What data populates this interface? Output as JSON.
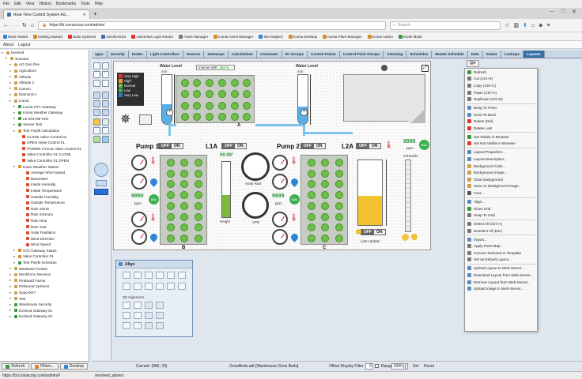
{
  "browser": {
    "menu": [
      "File",
      "Edit",
      "View",
      "History",
      "Bookmarks",
      "Tools",
      "Help"
    ],
    "tab_title": "Real-Time Control System Ad...",
    "url": "https://bi.iconiacorp.com/admin/",
    "search_placeholder": "Search",
    "bookmarks": [
      "Most Visited",
      "Getting Started",
      "Dalio Systems",
      "ADURASSS",
      "Universal Login Router",
      "Asset Manager",
      "Iconia Asset Manager",
      "SEAnalytics",
      "Iconia Desktop",
      "Iconia Plant Manager",
      "Iconia Admin",
      "Kiosk Mode"
    ],
    "status_url": "https://bi.iconiacorp.com/admin/#"
  },
  "app": {
    "menu": [
      "About",
      "Logout"
    ],
    "tabs": [
      "apps",
      "Security",
      "Nodes",
      "Light Controllers",
      "Devices",
      "Gateways",
      "Calculations",
      "Constants",
      "I/C Groups",
      "Control Points",
      "Control Point Groups",
      "Alarming",
      "Schedules",
      "Master Schedule",
      "Data",
      "Status",
      "Lookups",
      "Layouts"
    ],
    "active_tab": "Layouts",
    "bottom_buttons": [
      "Refresh",
      "Filters...",
      "Desktop"
    ],
    "footer_path": "/evolved_admin/"
  },
  "tree": [
    {
      "label": "Evolved",
      "indent": 0,
      "color": "#c9a14a"
    },
    {
      "label": "Sonoma",
      "indent": 1,
      "color": "#c9a14a"
    },
    {
      "label": "AG Geo Dev",
      "indent": 2,
      "color": "#c9a14a"
    },
    {
      "label": "Agriculture",
      "indent": 2,
      "color": "#c9a14a"
    },
    {
      "label": "Altitude",
      "indent": 2,
      "color": "#c9a14a"
    },
    {
      "label": "Altitude 2",
      "indent": 2,
      "color": "#c9a14a"
    },
    {
      "label": "Cavaro",
      "indent": 2,
      "color": "#c9a14a"
    },
    {
      "label": "Diamond A",
      "indent": 2,
      "color": "#c9a14a"
    },
    {
      "label": "Iconia",
      "indent": 2,
      "color": "#c9a14a"
    },
    {
      "label": "Iconia OTA Gateway",
      "indent": 3,
      "color": "#3a9a3a"
    },
    {
      "label": "Iconia Weather Gateway",
      "indent": 3,
      "color": "#3a9a3a"
    },
    {
      "label": "LE 8rl1786 Test",
      "indent": 3,
      "color": "#3a9a3a"
    },
    {
      "label": "Vernier Test",
      "indent": 3,
      "color": "#3a9a3a"
    },
    {
      "label": "Test Polyfit Calculation",
      "indent": 3,
      "color": "#d88a2a"
    },
    {
      "label": "CLOSE Valve Control 01",
      "indent": 4,
      "color": "#d84a2a"
    },
    {
      "label": "OPEN Valve Control 01",
      "indent": 4,
      "color": "#d84a2a"
    },
    {
      "label": "POWER CYCLE Valve Control 01",
      "indent": 4,
      "color": "#d84a2a"
    },
    {
      "label": "Valve Controller 01 CLOSE",
      "indent": 4,
      "color": "#d84a2a"
    },
    {
      "label": "Valve Controller 01 OPEN",
      "indent": 4,
      "color": "#d84a2a"
    },
    {
      "label": "Davis Weather Station",
      "indent": 3,
      "color": "#d88a2a"
    },
    {
      "label": "Average Wind Speed",
      "indent": 5,
      "color": "#d84a2a"
    },
    {
      "label": "Barometer",
      "indent": 5,
      "color": "#d84a2a"
    },
    {
      "label": "Inside Humidity",
      "indent": 5,
      "color": "#d84a2a"
    },
    {
      "label": "Inside Temperature",
      "indent": 5,
      "color": "#d84a2a"
    },
    {
      "label": "Outside Humidity",
      "indent": 5,
      "color": "#d84a2a"
    },
    {
      "label": "Outside Temperature",
      "indent": 5,
      "color": "#d84a2a"
    },
    {
      "label": "Rain 15min",
      "indent": 5,
      "color": "#d84a2a"
    },
    {
      "label": "Rain 24Hours",
      "indent": 5,
      "color": "#d84a2a"
    },
    {
      "label": "Rain Hour",
      "indent": 5,
      "color": "#d84a2a"
    },
    {
      "label": "Rain Year",
      "indent": 5,
      "color": "#d84a2a"
    },
    {
      "label": "Solar Radiation",
      "indent": 5,
      "color": "#d84a2a"
    },
    {
      "label": "Wind Direction",
      "indent": 5,
      "color": "#d84a2a"
    },
    {
      "label": "Wind Speed",
      "indent": 5,
      "color": "#d84a2a"
    },
    {
      "label": "OTA Gateway Status",
      "indent": 3,
      "color": "#d88a2a"
    },
    {
      "label": "Valve Controller 01",
      "indent": 3,
      "color": "#d88a2a"
    },
    {
      "label": "Test Polyfit Schedule",
      "indent": 3,
      "color": "#3a9a3a"
    },
    {
      "label": "Meadows Pontiac",
      "indent": 2,
      "color": "#c9a14a"
    },
    {
      "label": "Mockforce Services",
      "indent": 2,
      "color": "#c9a14a"
    },
    {
      "label": "PinBoard Farms",
      "indent": 2,
      "color": "#c9a14a"
    },
    {
      "label": "Redwood Systems",
      "indent": 2,
      "color": "#c9a14a"
    },
    {
      "label": "SpaceXtr7",
      "indent": 2,
      "color": "#c9a14a"
    },
    {
      "label": "Test",
      "indent": 2,
      "color": "#c9a14a"
    },
    {
      "label": "Warehouse Security",
      "indent": 2,
      "color": "#3a9a3a"
    },
    {
      "label": "Evolved Gateway 01",
      "indent": 2,
      "color": "#3a9a3a"
    },
    {
      "label": "Evolved Gateway 02",
      "indent": 2,
      "color": "#3a9a3a"
    }
  ],
  "canvas": {
    "legend": [
      "Very High",
      "High",
      "Normal",
      "Low",
      "Very Low"
    ],
    "legend_colors": [
      "#d33",
      "#f39b2f",
      "#6dbf47",
      "#3fae5a",
      "#2a7fbf"
    ],
    "water_level_label": "Water Level",
    "water_left_unit": "mm",
    "water_left_level": 0.4,
    "water_right_unit": "mm",
    "water_right_level": 0.35,
    "wifi_label": "Internet WiFi",
    "wifi_value": "333 %",
    "room_labels": [
      "A",
      "B",
      "C"
    ],
    "pump1": "Pump 1",
    "pump2": "Pump 2",
    "l1a": "L1A",
    "l2a": "L2A",
    "off": "OFF",
    "on": "ON",
    "temp_reading": "99.99°",
    "height_label": "Height",
    "height_level": 0.4,
    "solar_label": "Solar Rad",
    "vpd_label": "VPD",
    "ppm_left": "9999",
    "ppm_right": "9999",
    "ppm_unit": "ppm",
    "co2": "CO₂",
    "schedule_label": "Schedule",
    "last_update": "Last Update",
    "tank_level": 0.45
  },
  "align_panel": {
    "title": "Align",
    "subtitle": "3D Alignment"
  },
  "context_menu": [
    {
      "label": "Refresh",
      "color": "#3a9a3a"
    },
    {
      "label": "Cut (Ctrl+X)",
      "color": "#777"
    },
    {
      "label": "Copy (Ctrl+C)",
      "color": "#777"
    },
    {
      "label": "Paste (Ctrl+V)",
      "color": "#777"
    },
    {
      "label": "Duplicate (Ctrl+D)",
      "color": "#777"
    },
    {
      "sep": true
    },
    {
      "label": "Bring To Front",
      "color": "#5a8ac0"
    },
    {
      "label": "Send To Back",
      "color": "#5a8ac0"
    },
    {
      "label": "Delete (Del)",
      "color": "#d33"
    },
    {
      "label": "Delete Last",
      "color": "#d33"
    },
    {
      "sep": true
    },
    {
      "label": "Set Visible in Browser",
      "color": "#3a9a3a"
    },
    {
      "label": "Set Not Visible in Browser",
      "color": "#d33"
    },
    {
      "sep": true
    },
    {
      "label": "Layout Properties...",
      "color": "#5a8ac0"
    },
    {
      "label": "Layout Description...",
      "color": "#5a8ac0"
    },
    {
      "label": "Background Color...",
      "color": "#c9a14a"
    },
    {
      "label": "Background Image...",
      "color": "#c9a14a"
    },
    {
      "label": "Clear Background",
      "color": "#c9a14a"
    },
    {
      "label": "Save As Background Image...",
      "color": "#c9a14a"
    },
    {
      "label": "Font...",
      "color": "#555"
    },
    {
      "sep": true
    },
    {
      "label": "Align...",
      "color": "#5a8ac0"
    },
    {
      "label": "Show Grid",
      "color": "#3a9a3a"
    },
    {
      "label": "Snap To Grid",
      "color": "#777"
    },
    {
      "sep": true
    },
    {
      "label": "Select All (Ctrl+A)",
      "color": "#777"
    },
    {
      "label": "Deselect All (Esc)",
      "color": "#777"
    },
    {
      "sep": true
    },
    {
      "label": "Import...",
      "color": "#5a8ac0"
    },
    {
      "label": "Apply Point Map...",
      "color": "#777"
    },
    {
      "label": "Convert Selected to Template",
      "color": "#777"
    },
    {
      "label": "Set as Default Layout...",
      "color": "#777"
    },
    {
      "sep": true
    },
    {
      "label": "Upload Layout to Web-Server...",
      "color": "#5a8ac0"
    },
    {
      "label": "Download Layout from Web-Server...",
      "color": "#5a8ac0"
    },
    {
      "label": "Remove Layout from Web-Server...",
      "color": "#5a8ac0"
    },
    {
      "label": "Upload Image to Web-Server...",
      "color": "#5a8ac0"
    }
  ],
  "statusbar": {
    "current": "Current: (966, 33)",
    "grow_file": "GrowBeds.adt [Warehouse Grow Beds]",
    "offset_label": "Offset Display Filter",
    "offset_value": "0",
    "range_label": "Range",
    "range_value": "5000",
    "set": "Set",
    "reset": "Reset"
  }
}
